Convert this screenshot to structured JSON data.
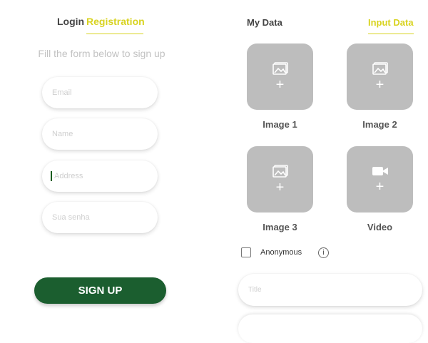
{
  "left": {
    "tabs": {
      "login": "Login",
      "registration": "Registration"
    },
    "subtitle": "Fill the form below to sign up",
    "fields": {
      "email_placeholder": "Email",
      "name_placeholder": "Name",
      "address_placeholder": "Address",
      "password_placeholder": "Sua senha"
    },
    "signup_label": "SIGN UP"
  },
  "right": {
    "tabs": {
      "my_data": "My Data",
      "input_data": "Input Data"
    },
    "media": [
      {
        "label": "Image 1",
        "icon": "image-icon"
      },
      {
        "label": "Image 2",
        "icon": "image-icon"
      },
      {
        "label": "Image 3",
        "icon": "image-icon"
      },
      {
        "label": "Video",
        "icon": "video-icon"
      }
    ],
    "anonymous_label": "Anonymous",
    "info_symbol": "i",
    "plus_symbol": "+",
    "title_placeholder": "Title"
  },
  "colors": {
    "accent": "#d8d320",
    "primary": "#1b5e2f",
    "tile": "#bdbdbd"
  }
}
